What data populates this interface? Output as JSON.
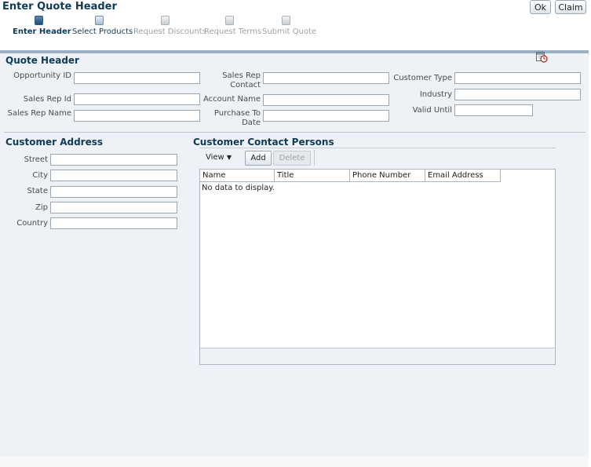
{
  "header": {
    "title": "Enter Quote Header",
    "ok_label": "Ok",
    "claim_label": "Claim"
  },
  "train": {
    "steps": [
      {
        "label": "Enter Header",
        "state": "active"
      },
      {
        "label": "Select Products",
        "state": "visited"
      },
      {
        "label": "Request Discounts",
        "state": "disabled"
      },
      {
        "label": "Request Terms",
        "state": "disabled"
      },
      {
        "label": "Submit Quote",
        "state": "disabled"
      }
    ]
  },
  "quote_header": {
    "title": "Quote Header",
    "opportunity_id": {
      "label": "Opportunity ID",
      "value": ""
    },
    "sales_rep_id": {
      "label": "Sales Rep Id",
      "value": ""
    },
    "sales_rep_name": {
      "label": "Sales Rep Name",
      "value": ""
    },
    "sales_rep_contact": {
      "label": "Sales Rep Contact",
      "value": ""
    },
    "account_name": {
      "label": "Account Name",
      "value": ""
    },
    "purchase_to_date": {
      "label": "Purchase To Date",
      "value": ""
    },
    "customer_type": {
      "label": "Customer Type",
      "value": ""
    },
    "industry": {
      "label": "Industry",
      "value": ""
    },
    "valid_until": {
      "label": "Valid Until",
      "value": "",
      "icon": "calendar-icon"
    }
  },
  "customer_address": {
    "title": "Customer Address",
    "street": {
      "label": "Street",
      "value": ""
    },
    "city": {
      "label": "City",
      "value": ""
    },
    "state": {
      "label": "State",
      "value": ""
    },
    "zip": {
      "label": "Zip",
      "value": ""
    },
    "country": {
      "label": "Country",
      "value": ""
    }
  },
  "contacts": {
    "title": "Customer Contact Persons",
    "view_label": "View",
    "add_label": "Add",
    "delete_label": "Delete",
    "columns": [
      "Name",
      "Title",
      "Phone Number",
      "Email Address"
    ],
    "empty_text": "No data to display."
  }
}
